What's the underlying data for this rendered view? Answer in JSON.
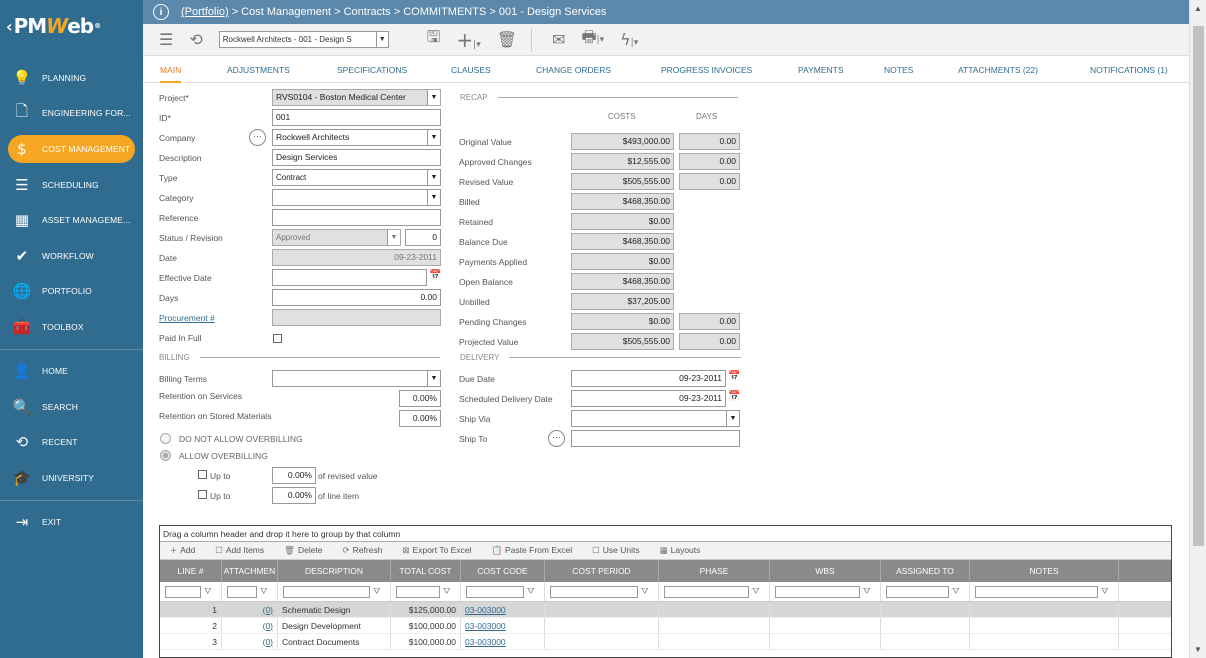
{
  "app": {
    "logo_prefix": "PM",
    "logo_w": "W",
    "logo_suffix": "eb",
    "logo_mark": "®"
  },
  "sidebar": {
    "items": [
      {
        "label": "PLANNING",
        "icon": "lightbulb-icon",
        "glyph": "💡"
      },
      {
        "label": "ENGINEERING FOR...",
        "icon": "document-icon",
        "glyph": "🗋"
      },
      {
        "label": "COST MANAGEMENT",
        "icon": "dollar-icon",
        "glyph": "$"
      },
      {
        "label": "SCHEDULING",
        "icon": "gantt-icon",
        "glyph": "☰"
      },
      {
        "label": "ASSET MANAGEME...",
        "icon": "building-icon",
        "glyph": "▦"
      },
      {
        "label": "WORKFLOW",
        "icon": "check-icon",
        "glyph": "✔"
      },
      {
        "label": "PORTFOLIO",
        "icon": "globe-icon",
        "glyph": "🌐"
      },
      {
        "label": "TOOLBOX",
        "icon": "toolbox-icon",
        "glyph": "🧰"
      }
    ],
    "items2": [
      {
        "label": "HOME",
        "icon": "user-icon",
        "glyph": "👤"
      },
      {
        "label": "SEARCH",
        "icon": "search-icon",
        "glyph": "🔍"
      },
      {
        "label": "RECENT",
        "icon": "history-icon",
        "glyph": "⟲"
      },
      {
        "label": "UNIVERSITY",
        "icon": "graduation-cap-icon",
        "glyph": "🎓"
      }
    ],
    "exit": {
      "label": "EXIT",
      "icon": "exit-icon",
      "glyph": "⇥"
    }
  },
  "breadcrumb": {
    "portfolio": "(Portfolio)",
    "rest": "> Cost Management > Contracts > COMMITMENTS > 001 - Design Services"
  },
  "toolbar": {
    "record_select": "Rockwell Architects - 001 - Design S"
  },
  "tabs": [
    "MAIN",
    "ADJUSTMENTS",
    "SPECIFICATIONS",
    "CLAUSES",
    "CHANGE ORDERS",
    "PROGRESS INVOICES",
    "PAYMENTS",
    "NOTES",
    "ATTACHMENTS (22)",
    "NOTIFICATIONS (1)"
  ],
  "form": {
    "project_label": "Project*",
    "project": "RVS0104 - Boston Medical Center",
    "id_label": "ID*",
    "id": "001",
    "company_label": "Company",
    "company": "Rockwell Architects",
    "description_label": "Description",
    "description": "Design Services",
    "type_label": "Type",
    "type": "Contract",
    "category_label": "Category",
    "category": "",
    "reference_label": "Reference",
    "reference": "",
    "status_label": "Status / Revision",
    "status": "Approved",
    "revision": "0",
    "date_label": "Date",
    "date": "09-23-2011",
    "effective_date_label": "Effective Date",
    "effective_date": "",
    "days_label": "Days",
    "days": "0.00",
    "procurement_label": "Procurement #",
    "procurement": "",
    "paid_in_full_label": "Paid In Full"
  },
  "billing": {
    "section": "BILLING",
    "terms_label": "Billing Terms",
    "terms": "",
    "ret_services_label": "Retention on Services",
    "ret_services": "0.00%",
    "ret_stored_label": "Retention on Stored Materials",
    "ret_stored": "0.00%",
    "no_overbill": "DO NOT ALLOW OVERBILLING",
    "allow_overbill": "ALLOW OVERBILLING",
    "upto_label": "Up to",
    "upto1": "0.00%",
    "upto1_suffix": "of revised value",
    "upto2": "0.00%",
    "upto2_suffix": "of line item"
  },
  "recap": {
    "section": "RECAP",
    "costs_header": "COSTS",
    "days_header": "DAYS",
    "rows": [
      {
        "label": "Original Value",
        "cost": "$493,000.00",
        "days": "0.00"
      },
      {
        "label": "Approved Changes",
        "cost": "$12,555.00",
        "days": "0.00"
      },
      {
        "label": "Revised Value",
        "cost": "$505,555.00",
        "days": "0.00"
      },
      {
        "label": "Billed",
        "cost": "$468,350.00"
      },
      {
        "label": "Retained",
        "cost": "$0.00"
      },
      {
        "label": "Balance Due",
        "cost": "$468,350.00"
      },
      {
        "label": "Payments Applied",
        "cost": "$0.00"
      },
      {
        "label": "Open Balance",
        "cost": "$468,350.00"
      },
      {
        "label": "Unbilled",
        "cost": "$37,205.00"
      },
      {
        "label": "Pending Changes",
        "cost": "$0.00",
        "days": "0.00"
      },
      {
        "label": "Projected Value",
        "cost": "$505,555.00",
        "days": "0.00"
      }
    ]
  },
  "delivery": {
    "section": "DELIVERY",
    "due_label": "Due Date",
    "due": "09-23-2011",
    "sched_label": "Scheduled Delivery Date",
    "sched": "09-23-2011",
    "shipvia_label": "Ship Via",
    "shipvia": "",
    "shipto_label": "Ship To",
    "shipto": ""
  },
  "grid": {
    "group_hint": "Drag a column header and drop it here to group by that column",
    "toolbar": [
      "Add",
      "Add Items",
      "Delete",
      "Refresh",
      "Export To Excel",
      "Paste From Excel",
      "Use Units",
      "Layouts"
    ],
    "columns": [
      "LINE #",
      "ATTACHMEN",
      "DESCRIPTION",
      "TOTAL COST",
      "COST CODE",
      "COST PERIOD",
      "PHASE",
      "WBS",
      "ASSIGNED TO",
      "NOTES"
    ],
    "rows": [
      {
        "line": "1",
        "att": "(0)",
        "desc": "Schematic Design",
        "cost": "$125,000.00",
        "code": "03-003000"
      },
      {
        "line": "2",
        "att": "(0)",
        "desc": "Design Development",
        "cost": "$100,000.00",
        "code": "03-003000"
      },
      {
        "line": "3",
        "att": "(0)",
        "desc": "Contract Documents",
        "cost": "$100,000.00",
        "code": "03-003000"
      }
    ]
  }
}
